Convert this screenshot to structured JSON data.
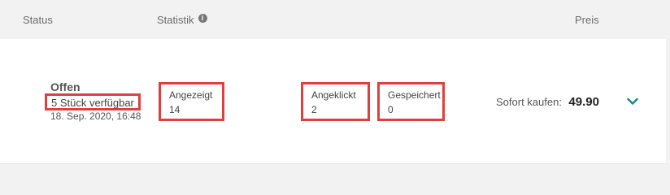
{
  "header": {
    "status": "Status",
    "statistik": "Statistik",
    "info_icon": "info-icon",
    "preis": "Preis"
  },
  "listing": {
    "status": "Offen",
    "availability": "5 Stück verfügbar",
    "date": "18. Sep. 2020, 16:48",
    "stats": {
      "shown_label": "Angezeigt",
      "shown_value": "14",
      "clicked_label": "Angeklickt",
      "clicked_value": "2",
      "saved_label": "Gespeichert",
      "saved_value": "0"
    },
    "price_label": "Sofort kaufen:",
    "price_value": "49.90",
    "expand_icon": "chevron-down-icon"
  },
  "colors": {
    "highlight": "#e0403c",
    "accent": "#1a8a7e",
    "background": "#f2f2f2"
  }
}
